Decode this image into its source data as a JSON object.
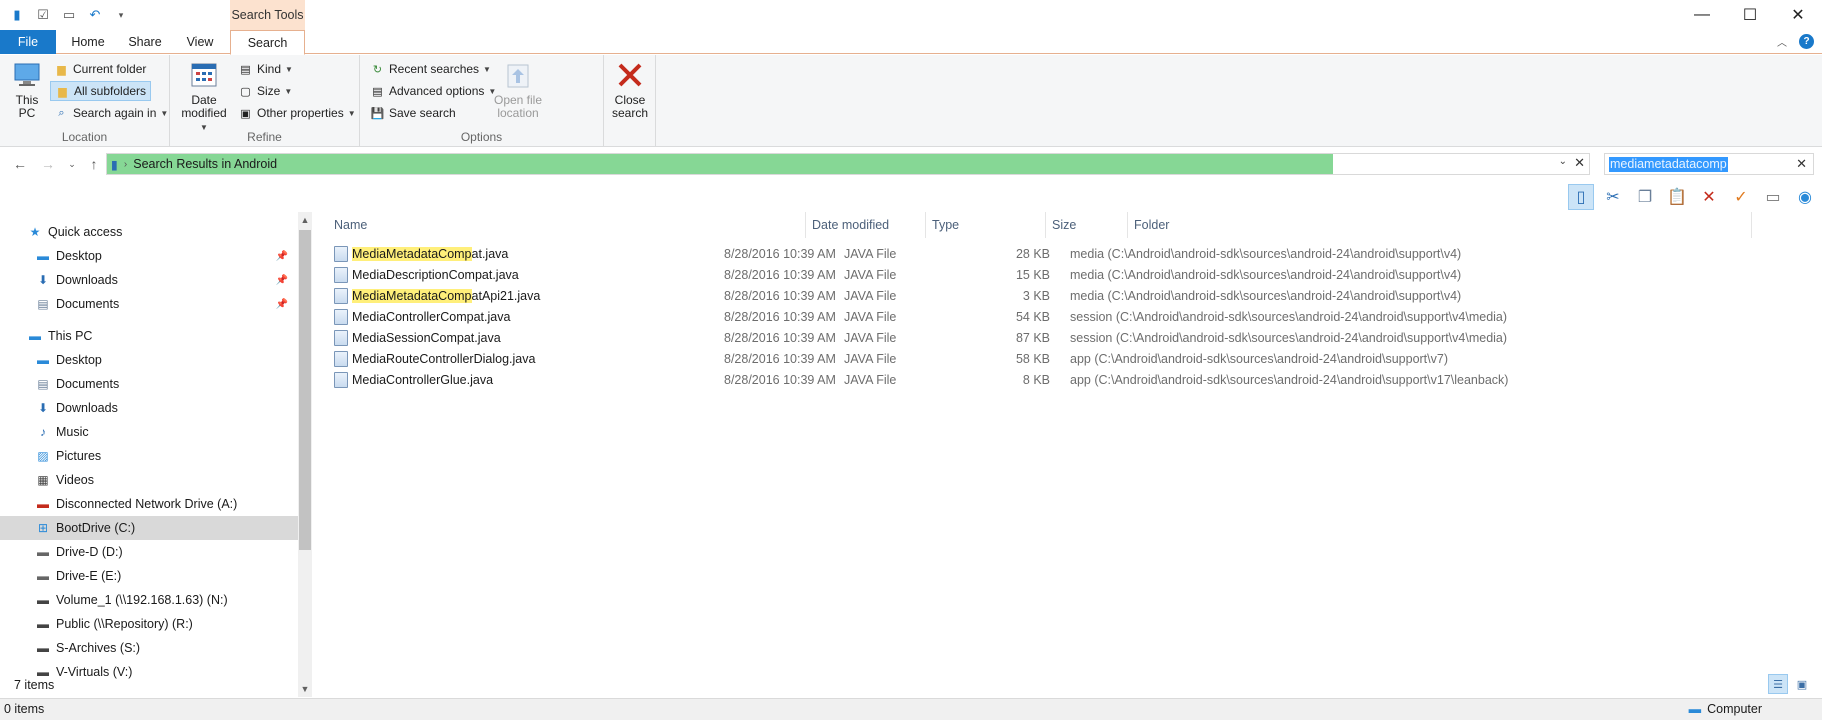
{
  "window": {
    "context_tab": "Search Tools",
    "controls": {
      "minimize": "—",
      "maximize": "☐",
      "close": "✕"
    }
  },
  "tabs": {
    "file": "File",
    "home": "Home",
    "share": "Share",
    "view": "View",
    "search": "Search"
  },
  "ribbon": {
    "location": {
      "label": "Location",
      "this_pc": "This PC",
      "current_folder": "Current folder",
      "all_subfolders": "All subfolders",
      "search_again": "Search again in"
    },
    "refine": {
      "label": "Refine",
      "date_modified_1": "Date",
      "date_modified_2": "modified",
      "kind": "Kind",
      "size": "Size",
      "other_properties": "Other properties"
    },
    "options": {
      "label": "Options",
      "recent_searches": "Recent searches",
      "advanced_options": "Advanced options",
      "save_search": "Save search",
      "open_file_location_1": "Open file",
      "open_file_location_2": "location"
    },
    "close": {
      "label_1": "Close",
      "label_2": "search"
    }
  },
  "address": {
    "breadcrumb": "Search Results in Android",
    "search_value": "mediametadatacomp"
  },
  "nav": {
    "quick_access": "Quick access",
    "qa_desktop": "Desktop",
    "qa_downloads": "Downloads",
    "qa_documents": "Documents",
    "this_pc": "This PC",
    "desktop": "Desktop",
    "documents": "Documents",
    "downloads": "Downloads",
    "music": "Music",
    "pictures": "Pictures",
    "videos": "Videos",
    "drive_a": "Disconnected Network Drive (A:)",
    "drive_c": "BootDrive (C:)",
    "drive_d": "Drive-D (D:)",
    "drive_e": "Drive-E (E:)",
    "drive_n": "Volume_1 (\\\\192.168.1.63) (N:)",
    "drive_r": "Public (\\\\Repository) (R:)",
    "drive_s": "S-Archives (S:)",
    "drive_v": "V-Virtuals (V:)"
  },
  "columns": {
    "name": "Name",
    "date": "Date modified",
    "type": "Type",
    "size": "Size",
    "folder": "Folder"
  },
  "files": [
    {
      "hl": "MediaMetadataComp",
      "rest": "at.java",
      "date": "8/28/2016 10:39 AM",
      "type": "JAVA File",
      "size": "28 KB",
      "folder": "media (C:\\Android\\android-sdk\\sources\\android-24\\android\\support\\v4)"
    },
    {
      "hl": "",
      "rest": "MediaDescriptionCompat.java",
      "date": "8/28/2016 10:39 AM",
      "type": "JAVA File",
      "size": "15 KB",
      "folder": "media (C:\\Android\\android-sdk\\sources\\android-24\\android\\support\\v4)"
    },
    {
      "hl": "MediaMetadataComp",
      "rest": "atApi21.java",
      "date": "8/28/2016 10:39 AM",
      "type": "JAVA File",
      "size": "3 KB",
      "folder": "media (C:\\Android\\android-sdk\\sources\\android-24\\android\\support\\v4)"
    },
    {
      "hl": "",
      "rest": "MediaControllerCompat.java",
      "date": "8/28/2016 10:39 AM",
      "type": "JAVA File",
      "size": "54 KB",
      "folder": "session (C:\\Android\\android-sdk\\sources\\android-24\\android\\support\\v4\\media)"
    },
    {
      "hl": "",
      "rest": "MediaSessionCompat.java",
      "date": "8/28/2016 10:39 AM",
      "type": "JAVA File",
      "size": "87 KB",
      "folder": "session (C:\\Android\\android-sdk\\sources\\android-24\\android\\support\\v4\\media)"
    },
    {
      "hl": "",
      "rest": "MediaRouteControllerDialog.java",
      "date": "8/28/2016 10:39 AM",
      "type": "JAVA File",
      "size": "58 KB",
      "folder": "app (C:\\Android\\android-sdk\\sources\\android-24\\android\\support\\v7)"
    },
    {
      "hl": "",
      "rest": "MediaControllerGlue.java",
      "date": "8/28/2016 10:39 AM",
      "type": "JAVA File",
      "size": "8 KB",
      "folder": "app (C:\\Android\\android-sdk\\sources\\android-24\\android\\support\\v17\\leanback)"
    }
  ],
  "status": {
    "items": "7 items",
    "selected": "0 items",
    "zone": "Computer"
  },
  "colors": {
    "accent": "#1979ca",
    "progress": "#86d795",
    "context_tab": "#fce2cf",
    "highlight": "#ffef7a"
  }
}
